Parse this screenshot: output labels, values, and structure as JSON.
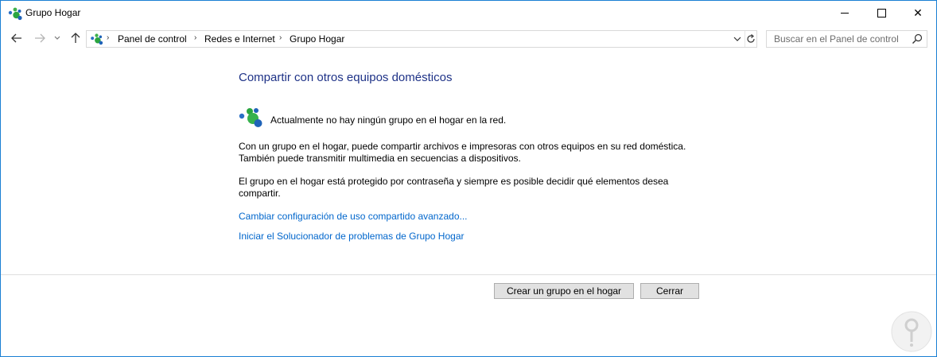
{
  "window": {
    "title": "Grupo Hogar",
    "controls": {
      "minimize": "minimize",
      "maximize": "maximize",
      "close": "✕"
    }
  },
  "nav": {
    "back_icon": "arrow-left-icon",
    "forward_icon": "arrow-right-icon",
    "recent_icon": "chevron-down-icon",
    "up_icon": "arrow-up-icon",
    "breadcrumb": [
      "Panel de control",
      "Redes e Internet",
      "Grupo Hogar"
    ],
    "search_placeholder": "Buscar en el Panel de control"
  },
  "content": {
    "heading": "Compartir con otros equipos domésticos",
    "status": "Actualmente no hay ningún grupo en el hogar en la red.",
    "paragraph1_line1": "Con un grupo en el hogar, puede compartir archivos e impresoras con otros equipos en su red doméstica.",
    "paragraph1_line2": "También puede transmitir multimedia en secuencias a dispositivos.",
    "paragraph2_line1": "El grupo en el hogar está protegido por contraseña y siempre es posible decidir qué elementos desea",
    "paragraph2_line2": "compartir.",
    "link_advanced": "Cambiar configuración de uso compartido avanzado...",
    "link_troubleshooter": "Iniciar el Solucionador de problemas de Grupo Hogar"
  },
  "buttons": {
    "create": "Crear un grupo en el hogar",
    "close": "Cerrar"
  },
  "colors": {
    "heading": "#1e3287",
    "link": "#0066cc",
    "window_border": "#1a7fd4",
    "button_bg": "#e1e1e1"
  }
}
